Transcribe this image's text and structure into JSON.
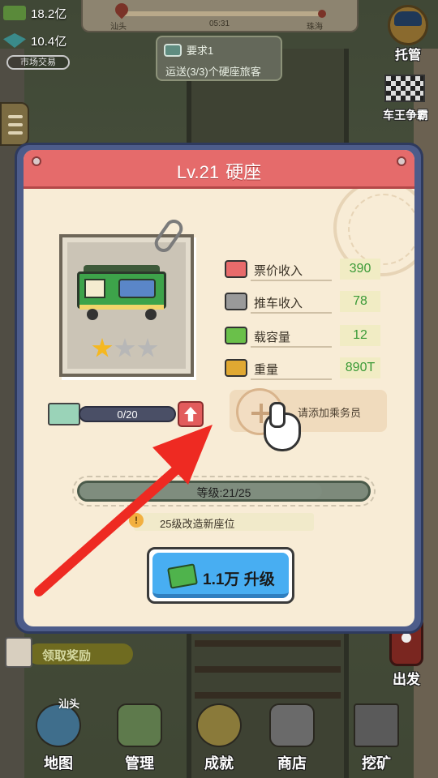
{
  "hud": {
    "cash_value": "18.2亿",
    "gem_value": "10.4亿",
    "market_label": "市场交易",
    "route": {
      "from": "汕头",
      "time": "05:31",
      "to": "珠海"
    },
    "task": {
      "title": "要求1",
      "description": "运送(3/3)个硬座旅客"
    },
    "auto_label": "托管",
    "race_label": "车王争霸",
    "depart_label": "出发",
    "reward_label": "领取奖励"
  },
  "dialog": {
    "title_level": "Lv.21",
    "title_name": "硬座",
    "stars": {
      "earned": 1,
      "total": 3
    },
    "xp_progress": "0/20",
    "stats": [
      {
        "icon": "ticket-icon",
        "label": "票价收入",
        "value": "390"
      },
      {
        "icon": "cart-icon",
        "label": "推车收入",
        "value": "78"
      },
      {
        "icon": "passenger-icon",
        "label": "载容量",
        "value": "12"
      },
      {
        "icon": "weight-icon",
        "label": "重量",
        "value": "890T"
      }
    ],
    "crew_prompt": "请添加乘务员",
    "level_text": "等级:21/25",
    "level_fraction": 0.84,
    "hint": "25级改造新座位",
    "upgrade_cost": "1.1万",
    "upgrade_label": "升级"
  },
  "nav": {
    "items": [
      {
        "label": "地图",
        "sub": "汕头"
      },
      {
        "label": "管理",
        "sub": ""
      },
      {
        "label": "成就",
        "sub": ""
      },
      {
        "label": "商店",
        "sub": ""
      },
      {
        "label": "挖矿",
        "sub": ""
      }
    ]
  },
  "colors": {
    "header_red": "#e56b6b",
    "popup_frame": "#4d5c8a",
    "stat_value_green": "#3a9a36",
    "upgrade_blue": "#48aef2",
    "arrow_red": "#ee2a22"
  }
}
